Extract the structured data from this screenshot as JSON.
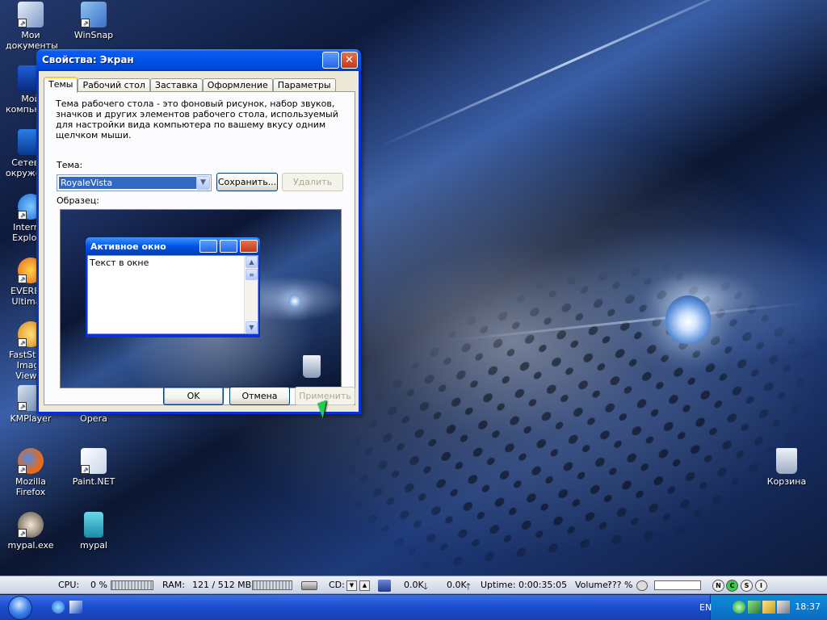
{
  "desktop": {
    "icons": [
      {
        "label": "Мои документы"
      },
      {
        "label": "WinSnap"
      },
      {
        "label": "Мой компьютер"
      },
      {
        "label": "Сетевое окружение"
      },
      {
        "label": "Internet Explorer"
      },
      {
        "label": "EVEREST Ultimate"
      },
      {
        "label": "FastStone Image Viewer"
      },
      {
        "label": "KMPlayer"
      },
      {
        "label": "Opera"
      },
      {
        "label": "Mozilla Firefox"
      },
      {
        "label": "Paint.NET"
      },
      {
        "label": "mypal.exe"
      },
      {
        "label": "mypal"
      },
      {
        "label": "Корзина"
      }
    ]
  },
  "dialog": {
    "title": "Свойства: Экран",
    "tabs": [
      "Темы",
      "Рабочий стол",
      "Заставка",
      "Оформление",
      "Параметры"
    ],
    "description": "Тема рабочего стола - это фоновый рисунок, набор звуков, значков и других элементов рабочего стола, используемый для настройки вида компьютера по вашему вкусу одним щелчком мыши.",
    "theme_label": "Тема:",
    "theme_value": "RoyaleVista",
    "save_button": "Сохранить...",
    "delete_button": "Удалить",
    "sample_label": "Образец:",
    "preview": {
      "window_title": "Активное окно",
      "window_text": "Текст в окне"
    },
    "ok_button": "OK",
    "cancel_button": "Отмена",
    "apply_button": "Применить"
  },
  "monitor": {
    "cpu_label": "CPU:",
    "cpu_value": "0 %",
    "ram_label": "RAM:",
    "ram_value": "121 / 512 MB",
    "cd_label": "CD:",
    "net_down": "0.0K",
    "net_up": "0.0K",
    "uptime_label": "Uptime:",
    "uptime_value": "0:00:35:05",
    "volume_label": "Volume:",
    "volume_value": "??? %",
    "circle_buttons": [
      "N",
      "C",
      "S",
      "I"
    ]
  },
  "taskbar": {
    "language": "EN",
    "clock": "18:37"
  },
  "colors": {
    "title_blue": "#0254e6",
    "dialog_face": "#ece9d8",
    "selection": "#316ac5",
    "taskbar_blue": "#1d4fd0"
  }
}
